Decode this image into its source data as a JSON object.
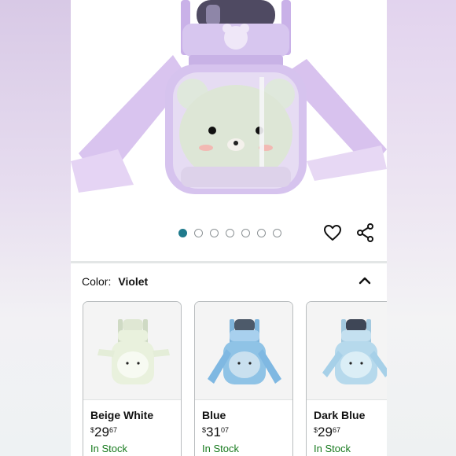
{
  "gallery": {
    "page_count": 7,
    "active_index": 0
  },
  "variation": {
    "label": "Color:",
    "selected": "Violet"
  },
  "swatches": [
    {
      "name": "Beige White",
      "currency": "$",
      "whole": "29",
      "fraction": "67",
      "stock": "In Stock",
      "tint": "#e9f1dd"
    },
    {
      "name": "Blue",
      "currency": "$",
      "whole": "31",
      "fraction": "07",
      "stock": "In Stock",
      "tint": "#8fc3e6"
    },
    {
      "name": "Dark Blue",
      "currency": "$",
      "whole": "29",
      "fraction": "67",
      "stock": "In Stock",
      "tint": "#b6d9ec"
    }
  ],
  "colors": {
    "pager_active": "#1f7a8c",
    "in_stock": "#177a1e",
    "product_violet": "#c9b3e6"
  }
}
